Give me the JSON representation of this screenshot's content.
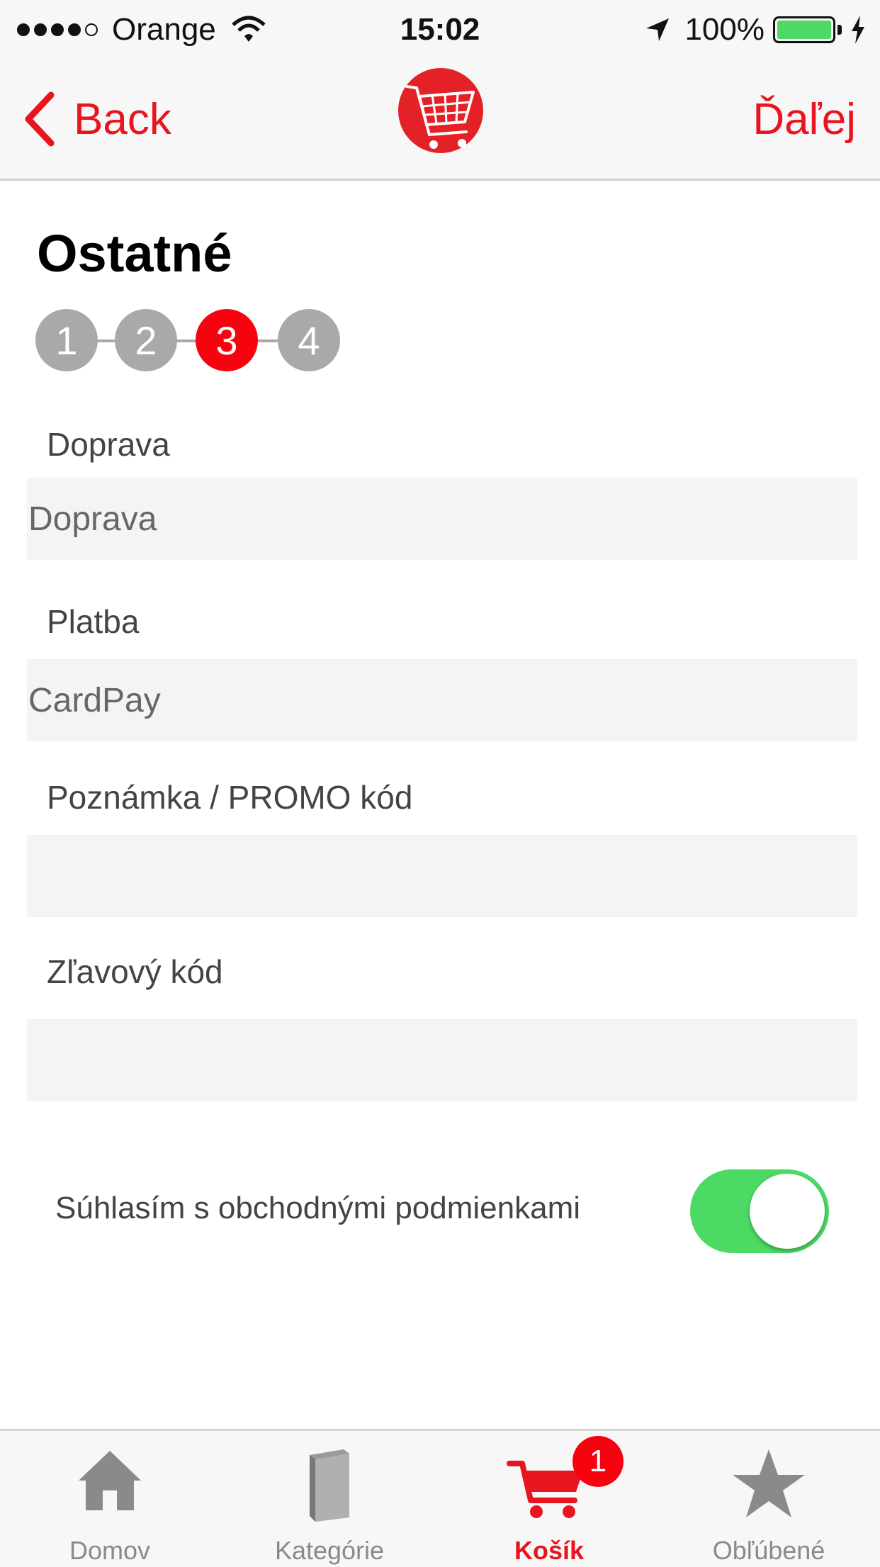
{
  "status_bar": {
    "carrier": "Orange",
    "time": "15:02",
    "battery": "100%",
    "signal_bars_filled": 4,
    "signal_bars_total": 5,
    "battery_level_fraction": 1.0
  },
  "nav": {
    "back_label": "Back",
    "next_label": "Ďaľej",
    "logo_icon": "shopping-cart-logo-icon",
    "accent_color": "#e8141e"
  },
  "page": {
    "title": "Ostatné",
    "steps": [
      "1",
      "2",
      "3",
      "4"
    ],
    "active_step": "3"
  },
  "form": {
    "doprava": {
      "label": "Doprava",
      "value": "Doprava"
    },
    "platba": {
      "label": "Platba",
      "value": "CardPay"
    },
    "poznamka": {
      "label": "Poznámka / PROMO kód",
      "value": ""
    },
    "zlavovy": {
      "label": "Zľavový kód",
      "value": ""
    },
    "agree": {
      "label": "Súhlasím s obchodnými podmienkami",
      "on": true,
      "on_color": "#4cd964"
    }
  },
  "tabbar": {
    "items": [
      {
        "label": "Domov",
        "icon": "home-icon"
      },
      {
        "label": "Kategórie",
        "icon": "book-icon"
      },
      {
        "label": "Košík",
        "icon": "cart-icon",
        "badge": "1",
        "active": true
      },
      {
        "label": "Obľúbené",
        "icon": "star-icon"
      }
    ]
  }
}
